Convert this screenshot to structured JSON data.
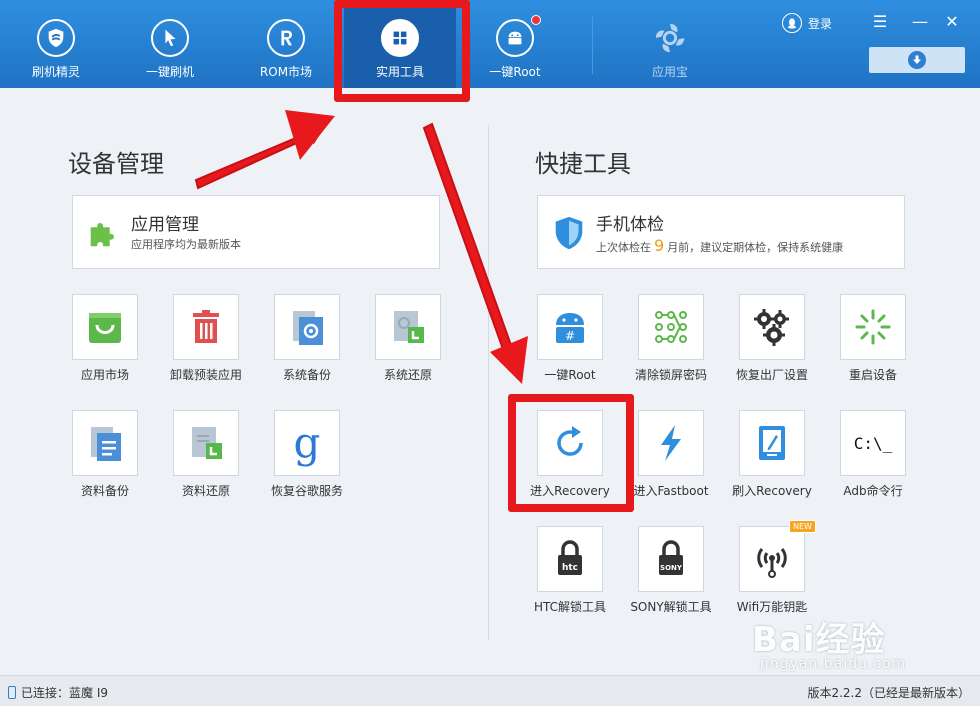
{
  "nav": {
    "items": [
      {
        "label": "刷机精灵",
        "icon": "shield-icon"
      },
      {
        "label": "一键刷机",
        "icon": "cursor-icon"
      },
      {
        "label": "ROM市场",
        "icon": "rom-icon"
      },
      {
        "label": "实用工具",
        "icon": "grid-icon"
      },
      {
        "label": "一键Root",
        "icon": "android-icon"
      },
      {
        "label": "应用宝",
        "icon": "app-treasure-icon"
      }
    ],
    "login": "登录"
  },
  "device_section": {
    "title": "设备管理",
    "card": {
      "title": "应用管理",
      "subtitle": "应用程序均为最新版本"
    },
    "tiles": [
      {
        "label": "应用市场"
      },
      {
        "label": "卸载预装应用"
      },
      {
        "label": "系统备份"
      },
      {
        "label": "系统还原"
      },
      {
        "label": "资料备份"
      },
      {
        "label": "资料还原"
      },
      {
        "label": "恢复谷歌服务"
      }
    ]
  },
  "quick_section": {
    "title": "快捷工具",
    "card": {
      "title": "手机体检",
      "sub_prefix": "上次体检在",
      "sub_number": "9",
      "sub_suffix": "月前，建议定期体检，保持系统健康"
    },
    "tiles": [
      {
        "label": "一键Root"
      },
      {
        "label": "清除锁屏密码"
      },
      {
        "label": "恢复出厂设置"
      },
      {
        "label": "重启设备"
      },
      {
        "label": "进入Recovery"
      },
      {
        "label": "进入Fastboot"
      },
      {
        "label": "刷入Recovery"
      },
      {
        "label": "Adb命令行"
      },
      {
        "label": "HTC解锁工具"
      },
      {
        "label": "SONY解锁工具"
      },
      {
        "label": "Wifi万能钥匙"
      }
    ],
    "adb_text": "C:\\_",
    "htc_text": "htc",
    "sony_text": "SONY",
    "new_badge": "NEW"
  },
  "status": {
    "connection": "已连接：蓝魔 I9",
    "version": "版本2.2.2（已经是最新版本）"
  },
  "watermark": {
    "main": "Bai经验",
    "sub": "jingyan.baidu.com"
  },
  "colors": {
    "accent": "#1f72c4",
    "annotation": "#e8191d",
    "highlight": "#f09a12"
  }
}
